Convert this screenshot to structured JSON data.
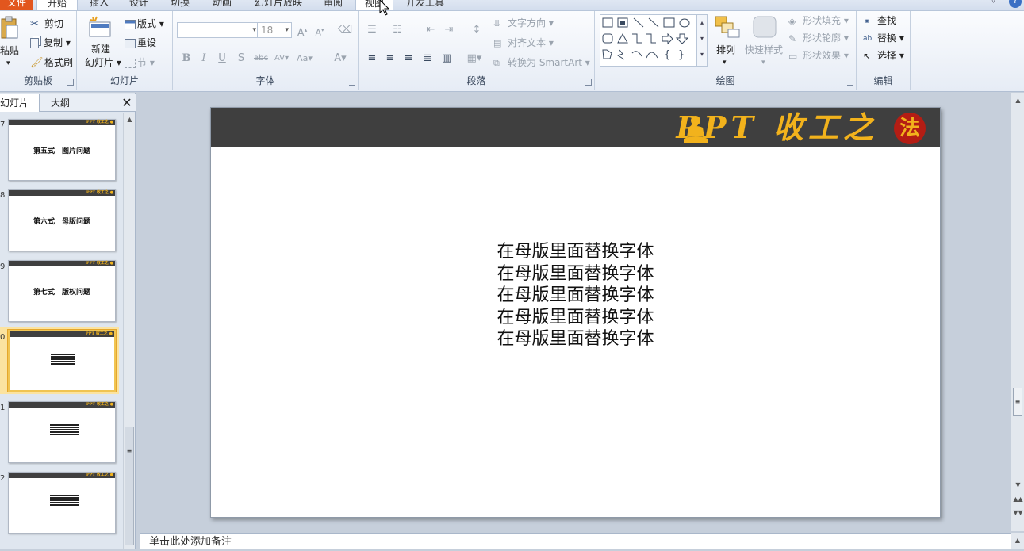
{
  "tabs": {
    "file": "文件",
    "home": "开始",
    "insert": "插入",
    "design": "设计",
    "transitions": "切换",
    "animations": "动画",
    "slideshow": "幻灯片放映",
    "review": "审阅",
    "view": "视图",
    "developer": "开发工具"
  },
  "clipboard": {
    "paste": "粘贴",
    "cut": "剪切",
    "copy": "复制",
    "format_painter": "格式刷",
    "label": "剪贴板"
  },
  "slides_group": {
    "new_slide_1": "新建",
    "new_slide_2": "幻灯片",
    "layout": "版式",
    "reset": "重设",
    "section": "节",
    "label": "幻灯片"
  },
  "font": {
    "size": "18",
    "label": "字体"
  },
  "paragraph": {
    "text_direction": "文字方向",
    "align_text": "对齐文本",
    "smartart": "转换为 SmartArt",
    "label": "段落"
  },
  "drawing": {
    "arrange": "排列",
    "quick_styles": "快速样式",
    "shape_fill": "形状填充",
    "shape_outline": "形状轮廓",
    "shape_effects": "形状效果",
    "label": "绘图"
  },
  "editing": {
    "find": "查找",
    "replace": "替换",
    "select": "选择",
    "label": "编辑"
  },
  "pane": {
    "tab_slides": "幻灯片",
    "tab_outline": "大纲"
  },
  "thumbnails": [
    {
      "num": "7",
      "text": "第五式　图片问题"
    },
    {
      "num": "8",
      "text": "第六式　母版问题"
    },
    {
      "num": "9",
      "text": "第七式　版权问题"
    },
    {
      "num": "0",
      "text": ""
    },
    {
      "num": "1",
      "text": ""
    },
    {
      "num": "2",
      "text": ""
    }
  ],
  "slide": {
    "logo_text": "PPT 收工之",
    "seal_char": "法",
    "lines": [
      "在母版里面替换字体",
      "在母版里面替换字体",
      "在母版里面替换字体",
      "在母版里面替换字体",
      "在母版里面替换字体"
    ]
  },
  "notes_placeholder": "单击此处添加备注",
  "colors": {
    "file_tab": "#e2561e",
    "slide_header": "#3f3f3f",
    "logo": "#f2b21c",
    "seal": "#b41d14"
  }
}
